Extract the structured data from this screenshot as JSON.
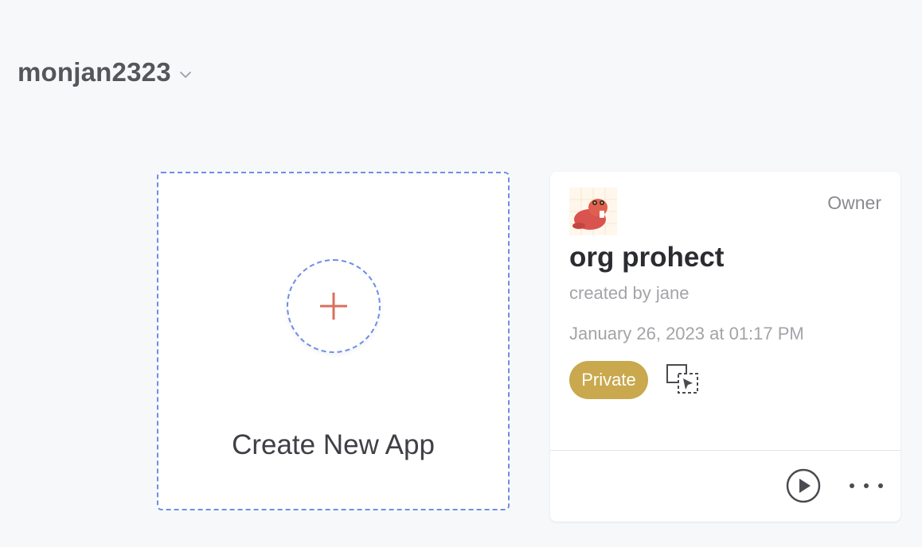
{
  "workspace": {
    "name": "monjan2323",
    "chevron_icon": "chevron-down-icon"
  },
  "create_card": {
    "label": "Create New App",
    "icon": "plus-icon",
    "accent_color": "#d9705f",
    "border_color": "#6d8ee8"
  },
  "apps": [
    {
      "title": "org prohect",
      "role": "Owner",
      "created_by": "created by jane",
      "date": "January 26, 2023 at 01:17 PM",
      "badge": "Private",
      "badge_color": "#c9a84e",
      "avatar_icon": "beaver-avatar-icon",
      "actions": {
        "select_icon": "multi-select-icon",
        "play_icon": "play-icon",
        "more_icon": "more-horizontal-icon"
      }
    }
  ]
}
